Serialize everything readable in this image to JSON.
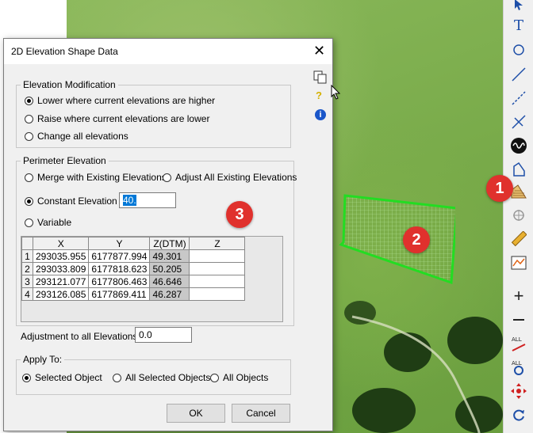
{
  "dialog": {
    "title": "2D Elevation Shape Data",
    "elevation_modification": {
      "label": "Elevation Modification",
      "options": [
        "Lower where current elevations are higher",
        "Raise where current elevations are lower",
        "Change all elevations"
      ],
      "selected_index": 0
    },
    "perimeter_elevation": {
      "label": "Perimeter Elevation",
      "merge_label": "Merge with Existing Elevations",
      "adjust_label": "Adjust All Existing Elevations",
      "constant_label": "Constant Elevation",
      "constant_value": "40.",
      "variable_label": "Variable",
      "selected": "constant"
    },
    "table": {
      "columns": [
        "X",
        "Y",
        "Z(DTM)",
        "Z"
      ],
      "rows": [
        {
          "index": "1",
          "x": "293035.955",
          "y": "6177877.994",
          "zdtm": "49.301",
          "z": ""
        },
        {
          "index": "2",
          "x": "293033.809",
          "y": "6177818.623",
          "zdtm": "50.205",
          "z": ""
        },
        {
          "index": "3",
          "x": "293121.077",
          "y": "6177806.463",
          "zdtm": "46.646",
          "z": ""
        },
        {
          "index": "4",
          "x": "293126.085",
          "y": "6177869.411",
          "zdtm": "46.287",
          "z": ""
        }
      ]
    },
    "adjustment_label": "Adjustment to all Elevations",
    "adjustment_value": "0.0",
    "apply_to": {
      "label": "Apply To:",
      "options": [
        "Selected Object",
        "All Selected Objects",
        "All Objects"
      ],
      "selected_index": 0
    },
    "ok_label": "OK",
    "cancel_label": "Cancel",
    "side_icons": [
      "copy-icon",
      "help-icon",
      "info-icon"
    ]
  },
  "annotations": [
    "1",
    "2",
    "3"
  ],
  "toolbar_icons": [
    "select-arrow-icon",
    "text-icon",
    "circle-icon",
    "line-icon",
    "dashed-line-icon",
    "split-icon",
    "waveform-icon",
    "polyline-icon",
    "elevation-shape-icon",
    "crosshair-icon",
    "ruler-icon",
    "profile-icon",
    "plus-icon",
    "minus-icon",
    "all-line-icon",
    "all-point-icon",
    "move-icon",
    "refresh-icon"
  ],
  "colors": {
    "badge": "#e0312d",
    "shape_outline": "#22dd22",
    "dialog_bg": "#f0f0f0",
    "ztdm_cell_bg": "#c8c8c8",
    "info_blue": "#1a56c9"
  }
}
